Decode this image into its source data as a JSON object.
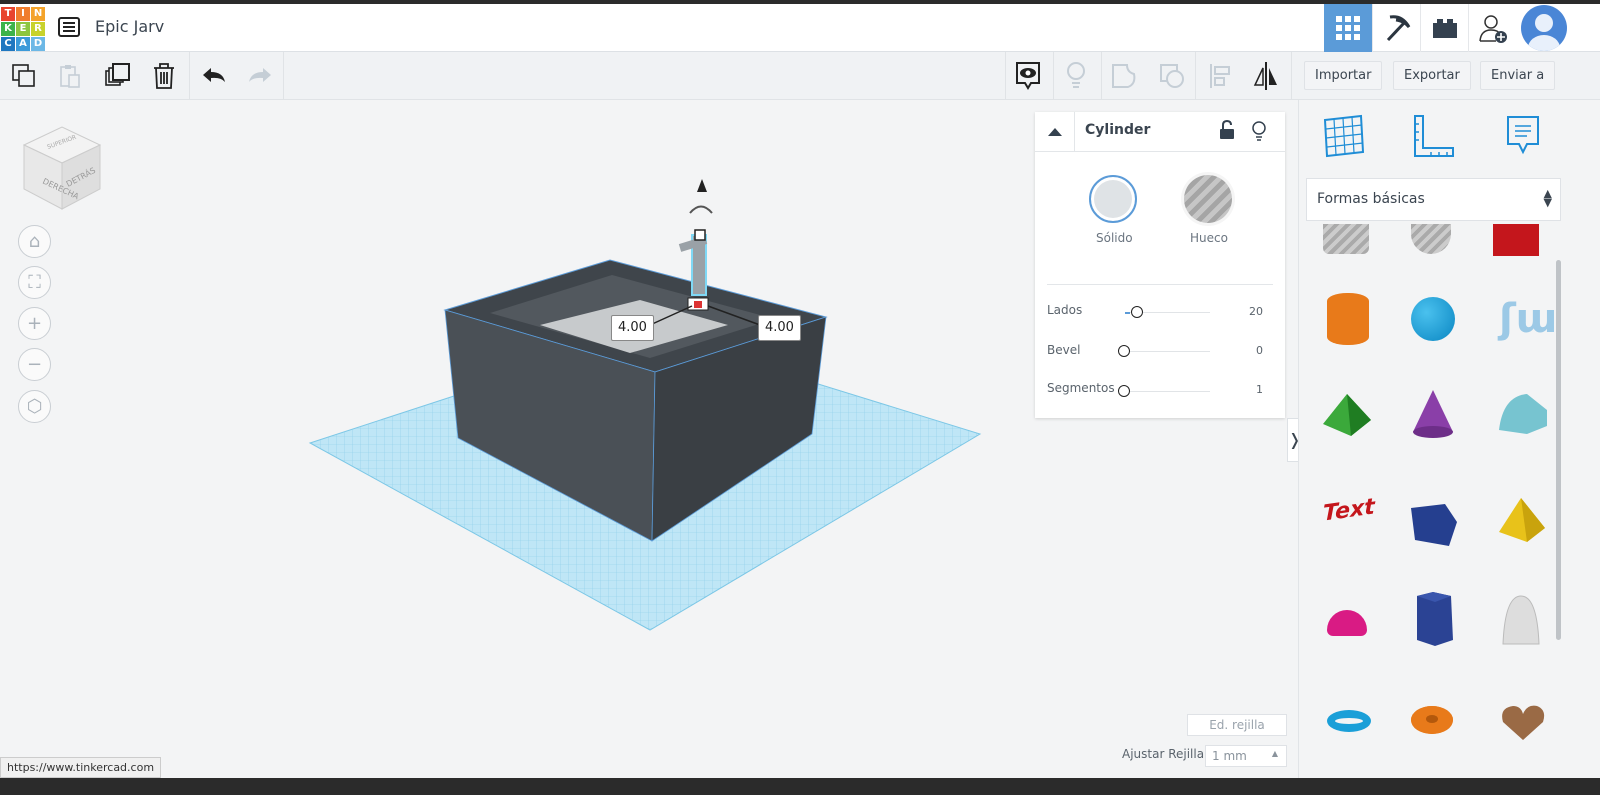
{
  "header": {
    "logo_letters": [
      "T",
      "I",
      "N",
      "K",
      "E",
      "R",
      "C",
      "A",
      "D"
    ],
    "title": "Epic Jarv"
  },
  "header_icons": [
    "3d-design-grid-icon",
    "pickaxe-icon",
    "brick-icon",
    "add-user-icon",
    "avatar-icon"
  ],
  "toolbar": {
    "import_label": "Importar",
    "export_label": "Exportar",
    "send_label": "Enviar a"
  },
  "viewcube": {
    "left": "DERECHA",
    "back": "DETRÁS",
    "top": "SUPERIOR"
  },
  "workplane": {
    "dim_x": "4.00",
    "dim_y": "4.00"
  },
  "inspector": {
    "title": "Cylinder",
    "solid_label": "Sólido",
    "hole_label": "Hueco",
    "selected": "solid",
    "params": [
      {
        "label": "Lados",
        "value": "20",
        "fraction": 0.1
      },
      {
        "label": "Bevel",
        "value": "0",
        "fraction": 0
      },
      {
        "label": "Segmentos",
        "value": "1",
        "fraction": 0
      }
    ]
  },
  "shapes_panel": {
    "category": "Formas básicas"
  },
  "grid": {
    "edit_label": "Ed. rejilla",
    "snap_label": "Ajustar Rejilla",
    "snap_value": "1 mm"
  },
  "statusbar": {
    "url": "https://www.tinkercad.com"
  },
  "colors": {
    "accent": "#5b9bd8",
    "grid": "#8fd3f0",
    "box": "#4a5056"
  }
}
